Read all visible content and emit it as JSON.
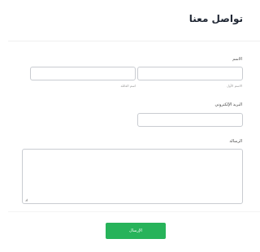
{
  "colors": {
    "accent": "#27b35a",
    "title": "#1f2633",
    "border": "#c9ccd1"
  },
  "form": {
    "title": "تواصل معنا",
    "name": {
      "label": "الاسم",
      "first_sublabel": "الاسم الأول",
      "last_sublabel": "اسم العائلة",
      "first_value": "",
      "last_value": ""
    },
    "email": {
      "label": "البريد الإلكتروني",
      "value": ""
    },
    "message": {
      "label": "الرسالة",
      "value": ""
    },
    "submit_label": "الإرسال"
  }
}
